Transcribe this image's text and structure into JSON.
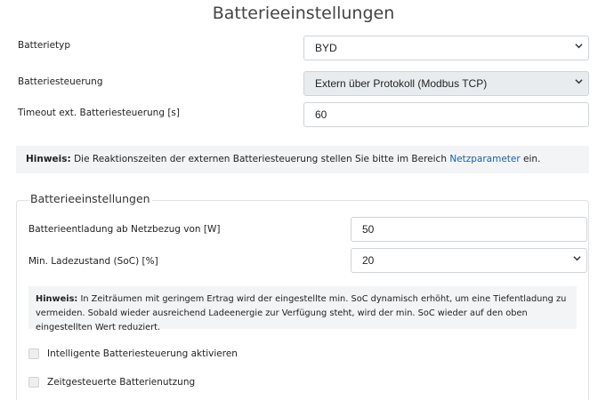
{
  "page_title": "Batterieeinstellungen",
  "battery_type": {
    "label": "Batterietyp",
    "value": "BYD"
  },
  "battery_control": {
    "label": "Batteriesteuerung",
    "value": "Extern über Protokoll (Modbus TCP)"
  },
  "timeout": {
    "label": "Timeout ext. Batteriesteuerung [s]",
    "value": "60"
  },
  "hint1": {
    "prefix": "Hinweis:",
    "text": " Die Reaktionszeiten der externen Batteriesteuerung stellen Sie bitte im Bereich ",
    "link": "Netzparameter",
    "suffix": " ein."
  },
  "settings_group": {
    "legend": "Batterieeinstellungen",
    "discharge": {
      "label": "Batterieentladung ab Netzbezug von [W]",
      "value": "50"
    },
    "min_soc": {
      "label": "Min. Ladezustand (SoC) [%]",
      "value": "20"
    },
    "hint2": {
      "prefix": "Hinweis:",
      "text": " In Zeiträumen mit geringem Ertrag wird der eingestellte min. SoC dynamisch erhöht, um eine Tiefentladung zu vermeiden. Sobald wieder ausreichend Ladeenergie zur Verfügung steht, wird der min. SoC wieder auf den oben eingestellten Wert reduziert."
    },
    "checkboxes": [
      {
        "label": "Intelligente Batteriesteuerung aktivieren",
        "checked": false
      },
      {
        "label": "Zeitgesteuerte Batterienutzung",
        "checked": false
      }
    ]
  },
  "icons": {
    "select_arrow": "chevron-down-icon"
  }
}
